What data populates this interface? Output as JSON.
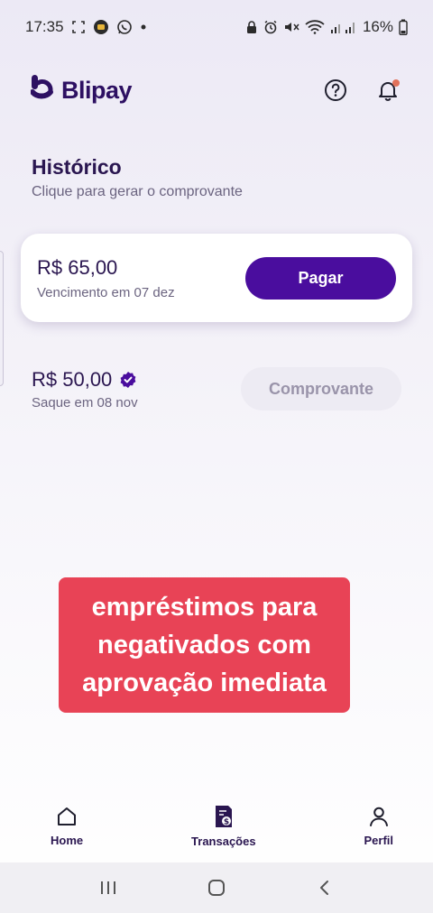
{
  "status_bar": {
    "time": "17:35",
    "battery": "16%",
    "icons": [
      "screenshot-icon",
      "app-notification-icon",
      "whatsapp-icon",
      "dot-icon",
      "lock-icon",
      "alarm-icon",
      "mute-icon",
      "wifi-icon",
      "signal-icon",
      "battery-icon"
    ]
  },
  "header": {
    "brand": "Blipay",
    "help_icon": "help-circle-icon",
    "notification_icon": "bell-icon",
    "brand_color": "#2d1062",
    "notification_dot_color": "#e2725b"
  },
  "history": {
    "title": "Histórico",
    "subtitle": "Clique para gerar o comprovante"
  },
  "transactions": [
    {
      "amount": "R$ 65,00",
      "detail": "Vencimento em 07 dez",
      "action": "Pagar"
    },
    {
      "amount": "R$ 50,00",
      "detail": "Saque em 08 nov",
      "action": "Comprovante",
      "verified_icon": "verified-badge-icon"
    }
  ],
  "banner": {
    "text": "empréstimos para negativados com aprovação imediata",
    "color": "#e84356"
  },
  "bottom_nav": {
    "items": [
      {
        "label": "Home",
        "icon": "home-icon"
      },
      {
        "label": "Transações",
        "icon": "transactions-icon"
      },
      {
        "label": "Perfil",
        "icon": "profile-icon"
      }
    ]
  },
  "system_nav": {
    "icons": [
      "recent-apps-icon",
      "home-circle-icon",
      "back-icon"
    ]
  },
  "colors": {
    "primary": "#4a0d9e",
    "text_dark": "#2a1650",
    "text_muted": "#6b6480",
    "disabled_bg": "#edebf3",
    "disabled_text": "#9a94aa"
  }
}
